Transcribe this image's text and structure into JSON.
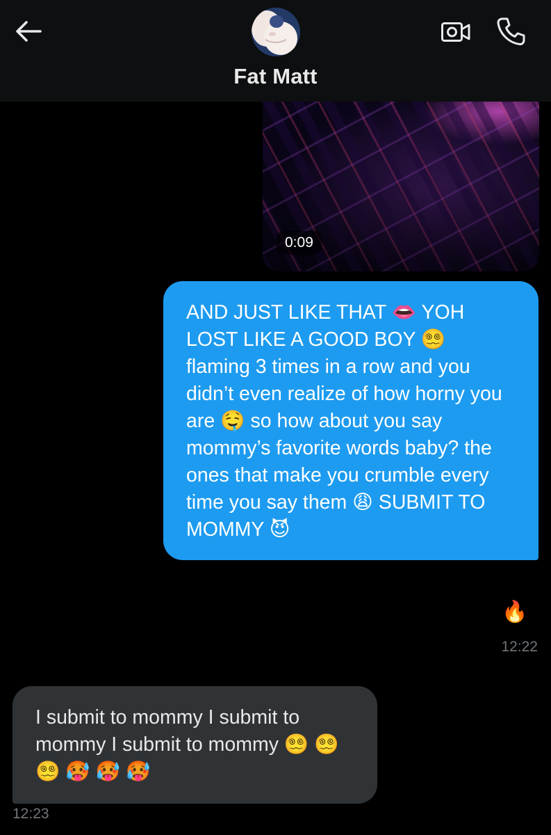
{
  "header": {
    "contact_name": "Fat Matt",
    "back_icon": "arrow-left-icon",
    "video_icon": "video-camera-icon",
    "call_icon": "phone-icon",
    "avatar_icon": "avatar"
  },
  "video_message": {
    "duration": "0:09"
  },
  "sent_message": {
    "text": "AND JUST LIKE THAT 👄 YOH LOST LIKE A GOOD BOY 😵‍💫 flaming 3 times in a row and you didn’t even realize of how horny you are 🤤 so how about you say mommy’s favorite words baby? the ones that make you crumble every time you say them 😩 SUBMIT TO MOMMY 😈",
    "reaction": "🔥",
    "time": "12:22"
  },
  "received_message": {
    "text": "I submit to mommy I submit to mommy I submit to mommy 😵‍💫 😵‍💫 😵‍💫 🥵 🥵 🥵",
    "time": "12:23"
  },
  "colors": {
    "background": "#000000",
    "header_background": "#0d0f10",
    "sent_bubble": "#1d9bf0",
    "received_bubble": "#2f3336",
    "timestamp": "#71767b"
  }
}
